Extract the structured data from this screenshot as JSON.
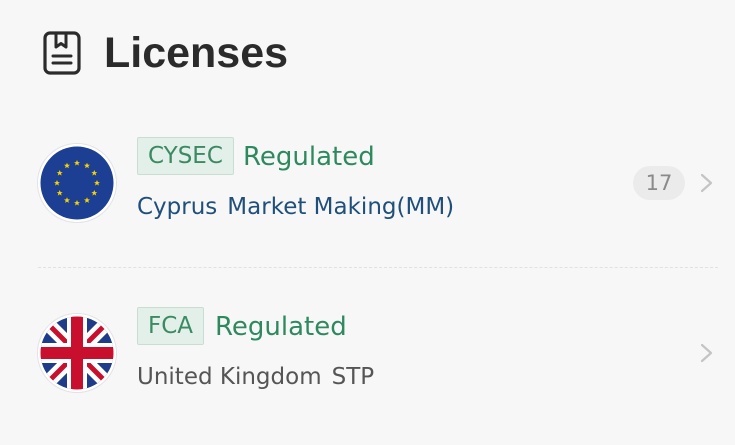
{
  "header": {
    "title": "Licenses",
    "icon": "license-document-icon"
  },
  "licenses": [
    {
      "flag_icon": "eu-flag-icon",
      "badge": "CYSEC",
      "status": "Regulated",
      "region": "Cyprus",
      "license_type": "Market Making(MM)",
      "count": "17",
      "accent": "#2e8a5e",
      "subline_color": "#1f4f7a"
    },
    {
      "flag_icon": "uk-flag-icon",
      "badge": "FCA",
      "status": "Regulated",
      "region": "United Kingdom",
      "license_type": "STP",
      "accent": "#2e8a5e",
      "subline_color": "#555555"
    }
  ]
}
